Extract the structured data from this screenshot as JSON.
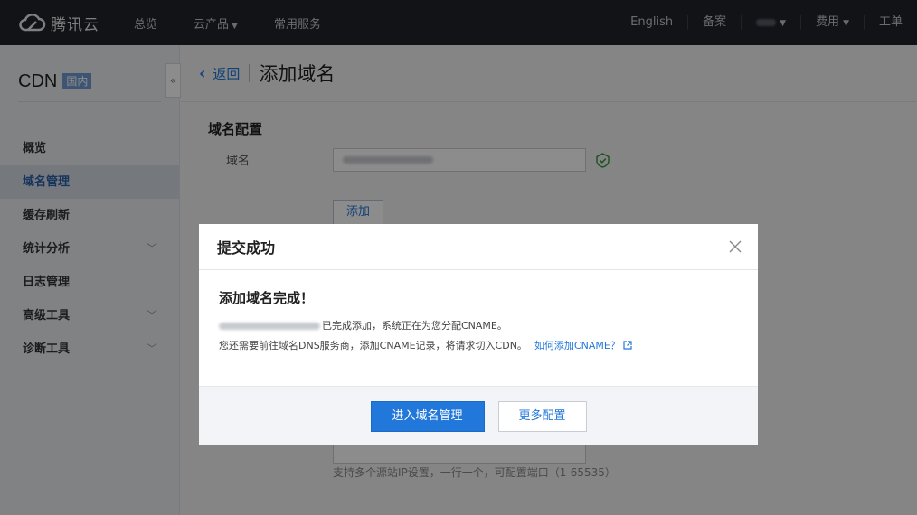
{
  "topbar": {
    "brand": "腾讯云",
    "nav": [
      {
        "label": "总览",
        "dropdown": false
      },
      {
        "label": "云产品",
        "dropdown": true
      },
      {
        "label": "常用服务",
        "dropdown": false
      }
    ],
    "right": {
      "language": "English",
      "beian": "备案",
      "billing": "费用",
      "ticket": "工单"
    }
  },
  "sidebar": {
    "product": "CDN",
    "badge": "国内",
    "collapse_icon": "«",
    "items": [
      {
        "label": "概览",
        "active": false,
        "expandable": false
      },
      {
        "label": "域名管理",
        "active": true,
        "expandable": false
      },
      {
        "label": "缓存刷新",
        "active": false,
        "expandable": false
      },
      {
        "label": "统计分析",
        "active": false,
        "expandable": true
      },
      {
        "label": "日志管理",
        "active": false,
        "expandable": false
      },
      {
        "label": "高级工具",
        "active": false,
        "expandable": true
      },
      {
        "label": "诊断工具",
        "active": false,
        "expandable": true
      }
    ]
  },
  "page": {
    "back_label": "返回",
    "title": "添加域名",
    "section_title": "域名配置",
    "domain_label": "域名",
    "add_button": "添加",
    "origin_hint": "支持多个源站IP设置，一行一个，可配置端口（1-65535）"
  },
  "modal": {
    "title": "提交成功",
    "heading": "添加域名完成！",
    "line1_suffix": "已完成添加，系统正在为您分配CNAME。",
    "line2": "您还需要前往域名DNS服务商，添加CNAME记录，将请求切入CDN。",
    "help_link": "如何添加CNAME？",
    "primary_button": "进入域名管理",
    "secondary_button": "更多配置"
  },
  "colors": {
    "accent": "#2277da",
    "topbar": "#202329",
    "success": "#3a9a3e"
  }
}
